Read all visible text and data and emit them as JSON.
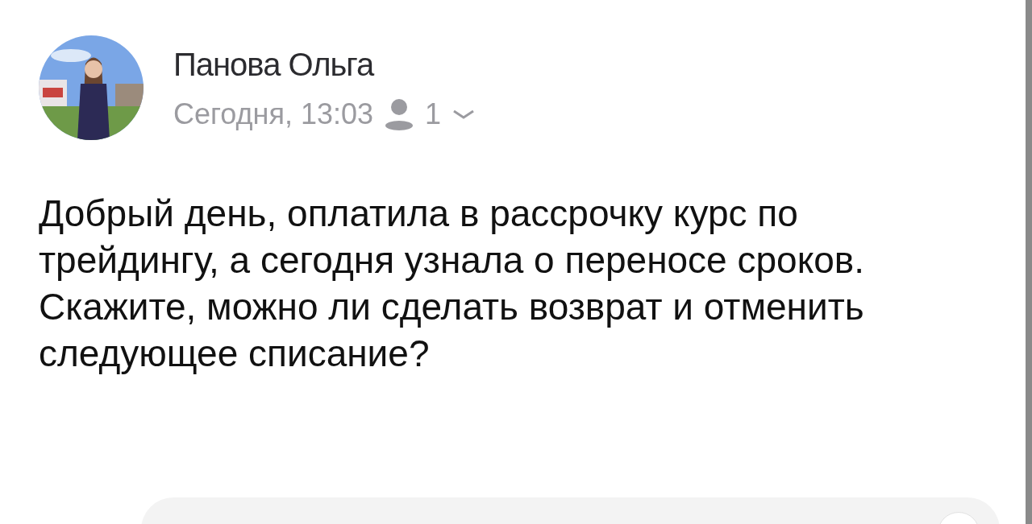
{
  "message": {
    "sender": "Панова Ольга",
    "time": "Сегодня, 13:03",
    "recipients_count": "1",
    "recipients_expanded": false,
    "body": "Добрый день, оплатила в рассрочку курс по трейдингу, а сегодня узнала о переносе сроков. Скажите, можно ли сделать возврат и отменить следующее списание?"
  }
}
